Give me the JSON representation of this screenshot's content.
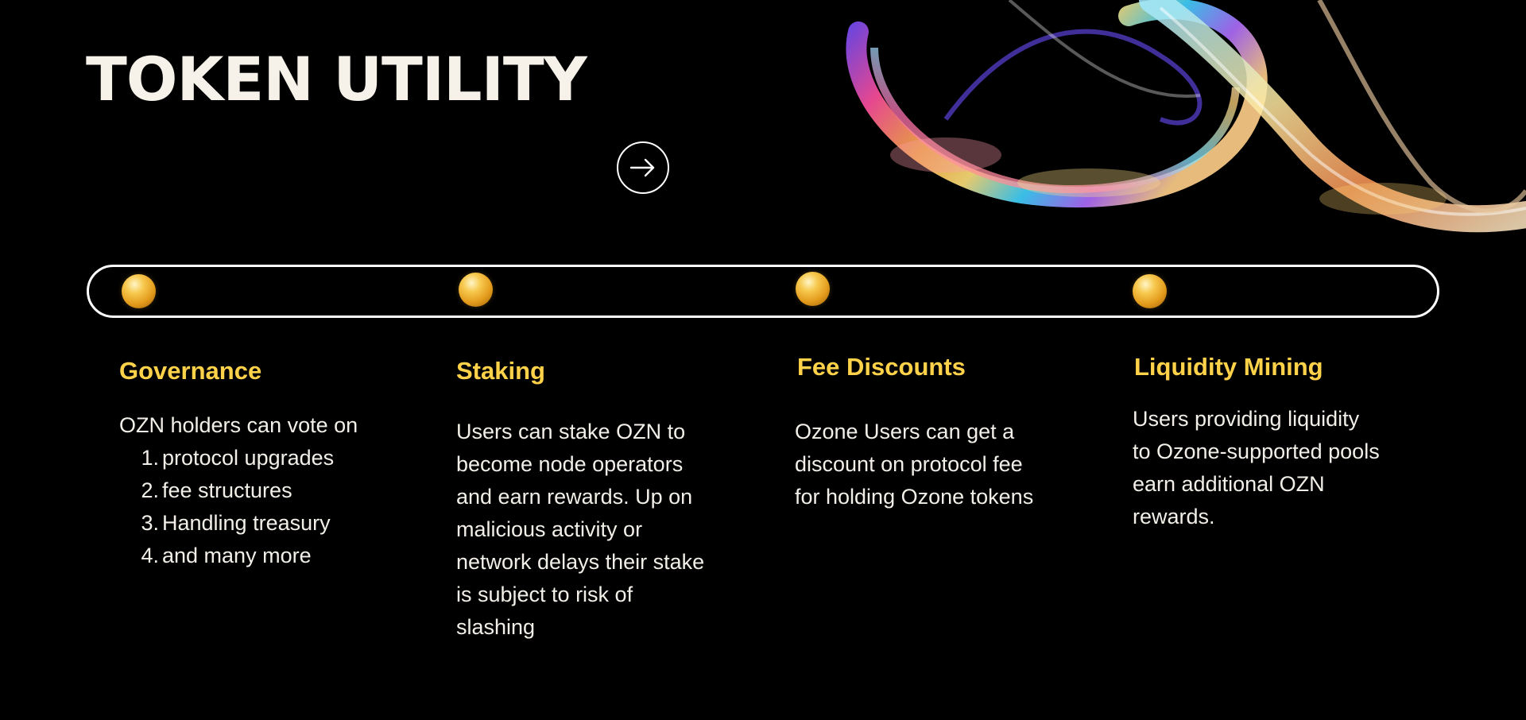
{
  "header": {
    "title": "TOKEN UTILITY",
    "next_icon": "arrow-right-icon"
  },
  "decoration": {
    "hero_art": "iridescent-glass-ribbon",
    "orb_color": "#f2b531",
    "accent_color": "#ffd24a"
  },
  "features": [
    {
      "title": "Governance",
      "intro": "OZN holders can vote on",
      "items": [
        {
          "num": "1.",
          "text": "protocol upgrades"
        },
        {
          "num": "2.",
          "text": "fee structures"
        },
        {
          "num": "3.",
          "text": "Handling treasury"
        },
        {
          "num": "4.",
          "text": "and many more"
        }
      ]
    },
    {
      "title": "Staking",
      "lines": [
        "Users can stake OZN to",
        "become node operators",
        "and earn rewards. Up on",
        "malicious activity or",
        "network delays their stake",
        "is subject to risk of",
        "slashing"
      ]
    },
    {
      "title": "Fee Discounts",
      "lines": [
        "Ozone Users can get a",
        "discount on protocol fee",
        "for holding Ozone tokens"
      ]
    },
    {
      "title": "Liquidity Mining",
      "lines": [
        "Users providing liquidity",
        "to Ozone-supported pools",
        "earn additional OZN",
        "rewards."
      ]
    }
  ]
}
